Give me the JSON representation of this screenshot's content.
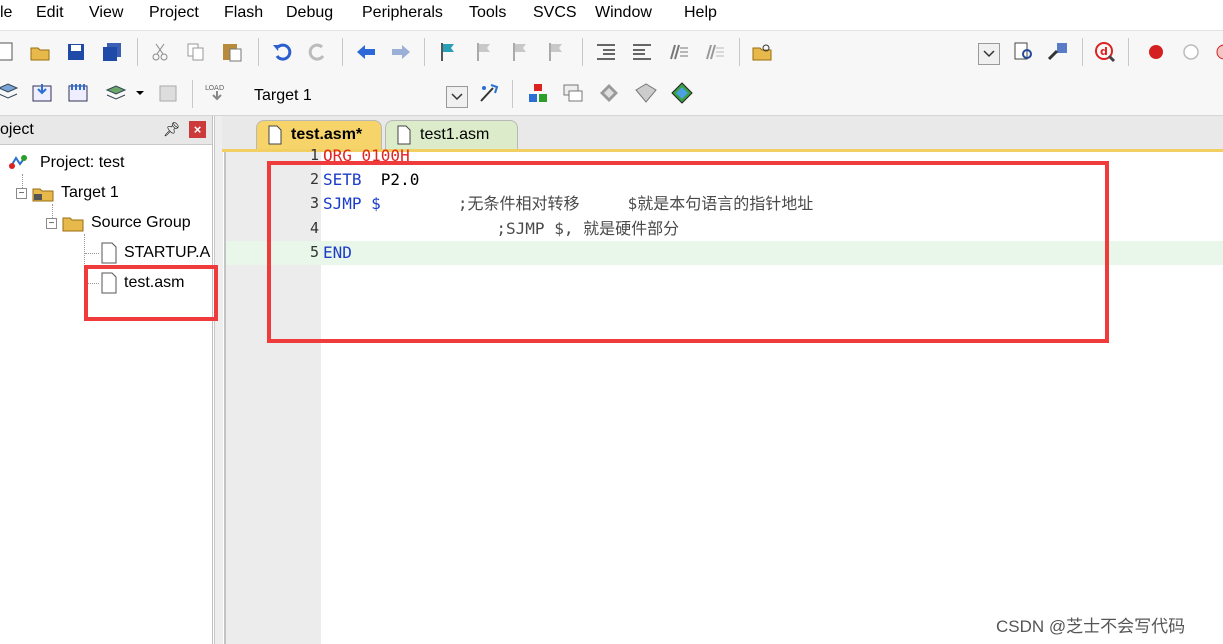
{
  "menu": [
    "le",
    "Edit",
    "View",
    "Project",
    "Flash",
    "Debug",
    "Peripherals",
    "Tools",
    "SVCS",
    "Window",
    "Help"
  ],
  "toolbar2": {
    "target_label": "Target 1"
  },
  "toolbar1_icons": [
    "new-file-icon",
    "open-file-icon",
    "save-icon",
    "save-all-icon",
    "cut-icon",
    "copy-icon",
    "paste-icon",
    "undo-icon",
    "redo-icon",
    "navigate-back-icon",
    "navigate-forward-icon",
    "bookmark-icon",
    "prev-bookmark-icon",
    "next-bookmark-icon",
    "clear-bookmarks-icon",
    "indent-icon",
    "unindent-icon",
    "comment-icon",
    "uncomment-icon",
    "find-in-files-icon",
    "find-icon",
    "configure-icon",
    "debug-session-icon",
    "breakpoint-icon",
    "disable-breakpoint-icon"
  ],
  "project_panel": {
    "title": "oject",
    "items": [
      {
        "label": "Project: test",
        "icon": "project-icon"
      },
      {
        "label": "Target 1",
        "icon": "target-icon"
      },
      {
        "label": "Source Group",
        "icon": "folder-icon"
      },
      {
        "label": "STARTUP.A",
        "icon": "file-icon"
      },
      {
        "label": "test.asm",
        "icon": "file-icon"
      }
    ]
  },
  "tabs": [
    {
      "label": "test.asm*",
      "active": true
    },
    {
      "label": "test1.asm",
      "active": false
    }
  ],
  "code_lines": [
    {
      "num": "1",
      "parts": [
        {
          "text": "ORG 0100H",
          "cls": "kwred"
        }
      ]
    },
    {
      "num": "2",
      "parts": [
        {
          "text": "SETB",
          "cls": "kw"
        },
        {
          "text": "  P2.0",
          "cls": ""
        }
      ]
    },
    {
      "num": "3",
      "parts": [
        {
          "text": "SJMP $",
          "cls": "kw"
        },
        {
          "text": "        ;无条件相对转移     $就是本句语言的指针地址",
          "cls": "cm"
        }
      ]
    },
    {
      "num": "4",
      "parts": [
        {
          "text": "                  ;SJMP $, 就是硬件部分",
          "cls": "cm"
        }
      ]
    },
    {
      "num": "5",
      "parts": [
        {
          "text": "END",
          "cls": "kw"
        }
      ]
    }
  ],
  "watermark": "CSDN @芝士不会写代码",
  "colors": {
    "annotation_red": "#ef3b3b",
    "active_tab": "#f6d46a",
    "keyword_blue": "#1a3cc9",
    "current_line": "#e8f7ea"
  }
}
